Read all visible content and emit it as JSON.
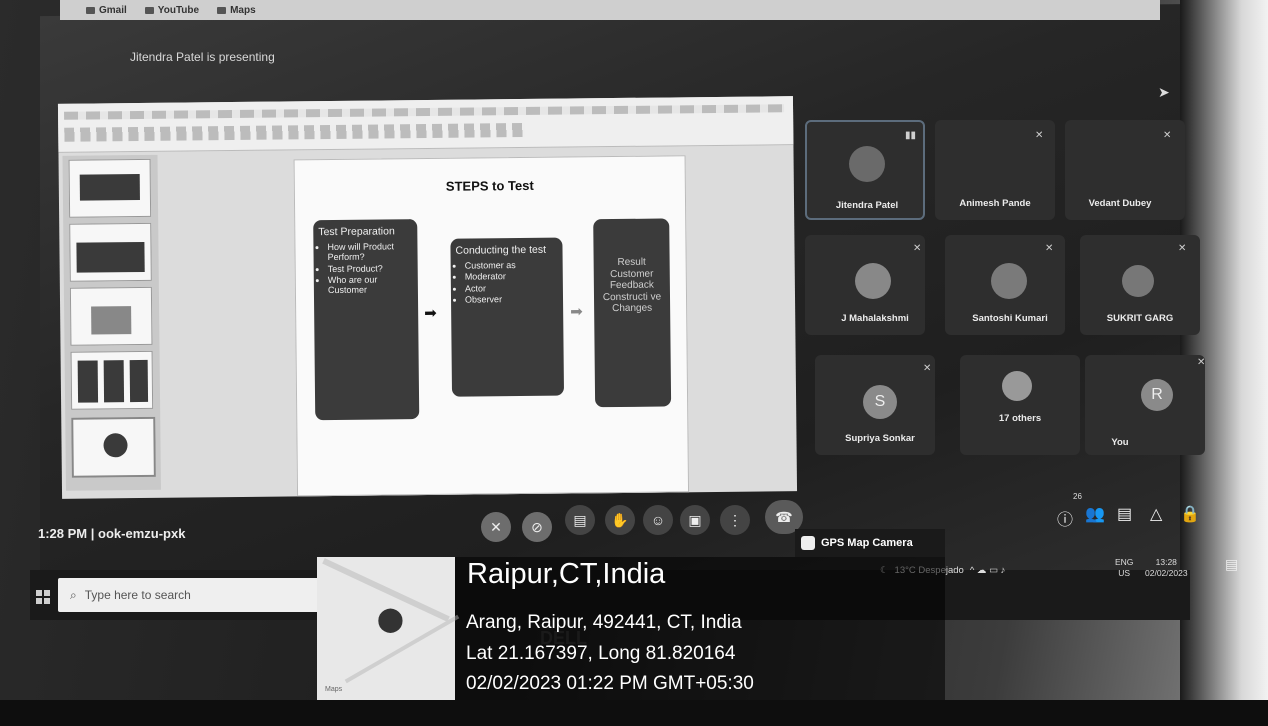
{
  "browser": {
    "bookmarks": [
      "Gmail",
      "YouTube",
      "Maps"
    ]
  },
  "meeting": {
    "presenting_text": "Jitendra Patel is presenting",
    "time": "1:28 PM",
    "separator": "|",
    "meeting_code": "ook-emzu-pxk",
    "people_count": "26"
  },
  "slide": {
    "title": "STEPS to Test",
    "box1": {
      "heading": "Test Preparation",
      "items": [
        "How will Product Perform?",
        "Test Product?",
        "Who are our Customer"
      ]
    },
    "box2": {
      "heading": "Conducting the test",
      "items": [
        "Customer as",
        "Moderator",
        "Actor",
        "Observer"
      ]
    },
    "box3": {
      "lines": [
        "Result",
        "Customer Feedback",
        "Constructi ve Changes"
      ]
    }
  },
  "participants": [
    {
      "name": "Jitendra Patel",
      "initial": ""
    },
    {
      "name": "Animesh Pande",
      "initial": ""
    },
    {
      "name": "Vedant Dubey",
      "initial": ""
    },
    {
      "name": "J Mahalakshmi",
      "initial": ""
    },
    {
      "name": "Santoshi Kumari",
      "initial": ""
    },
    {
      "name": "SUKRIT GARG",
      "initial": ""
    },
    {
      "name": "Supriya Sonkar",
      "initial": "S"
    },
    {
      "name": "17 others",
      "initial": ""
    },
    {
      "name": "You",
      "initial": "R"
    }
  ],
  "taskbar": {
    "search_placeholder": "Type here to search",
    "weather": "13°C  Despejado",
    "lang1": "ENG",
    "lang2": "US",
    "clock_time": "13:28",
    "clock_date": "02/02/2023"
  },
  "gps": {
    "badge": "GPS Map Camera",
    "city": "Raipur,CT,India",
    "address": "Arang, Raipur, 492441, CT, India",
    "coords": "Lat 21.167397, Long 81.820164",
    "datetime": "02/02/2023 01:22 PM GMT+05:30",
    "maps_label": "Maps"
  },
  "icons": [
    "mic-off-icon",
    "camera-off-icon",
    "captions-icon",
    "raise-hand-icon",
    "emoji-icon",
    "present-icon",
    "more-icon",
    "end-call-icon",
    "info-icon",
    "people-icon",
    "chat-icon",
    "activities-icon",
    "lock-icon",
    "search-icon",
    "windows-icon",
    "location-pin-icon"
  ]
}
